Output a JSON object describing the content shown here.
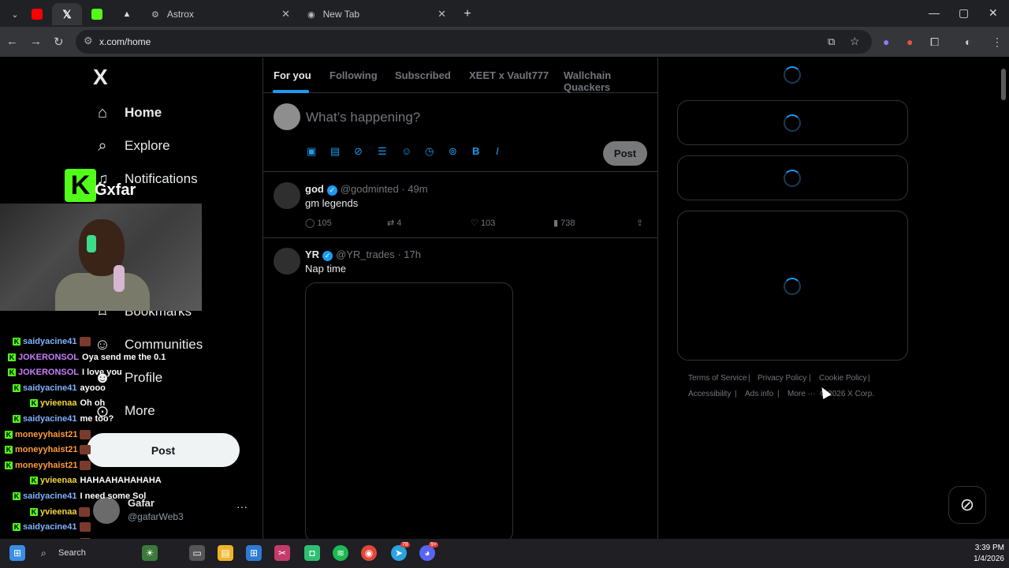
{
  "browser": {
    "tabs": [
      {
        "label": "",
        "favicon": "youtube-icon",
        "color": "#ff0000"
      },
      {
        "label": "",
        "favicon": "x-icon",
        "color": "#e7e9ea"
      },
      {
        "label": "",
        "favicon": "kick-icon",
        "color": "#53fc18"
      },
      {
        "label": "",
        "favicon": "drive-icon",
        "color": "#e7e9ea"
      },
      {
        "label": "Astrox",
        "favicon": "globe-icon"
      },
      {
        "label": "New Tab",
        "favicon": "chrome-icon"
      }
    ],
    "new_tab_symbol": "+",
    "url": "x.com/home"
  },
  "sidebar": {
    "logo": "X",
    "items": [
      {
        "label": "Home",
        "icon": "home-icon"
      },
      {
        "label": "Explore",
        "icon": "search-icon"
      },
      {
        "label": "Notifications",
        "icon": "bell-icon"
      },
      {
        "label": "Bookmarks",
        "icon": "bookmark-icon"
      },
      {
        "label": "Communities",
        "icon": "communities-icon"
      },
      {
        "label": "Profile",
        "icon": "person-icon"
      },
      {
        "label": "More",
        "icon": "more-circle-icon"
      }
    ],
    "post_label": "Post",
    "account": {
      "name": "Gafar",
      "handle": "@gafarWeb3"
    }
  },
  "stream": {
    "logo_letter": "K",
    "name": "Gxfar",
    "chat": [
      {
        "user": "saidyacine41",
        "color": "#7fb2ff",
        "msg": ""
      },
      {
        "user": "JOKERONSOL",
        "color": "#c77dff",
        "msg": "Oya send me the 0.1"
      },
      {
        "user": "JOKERONSOL",
        "color": "#c77dff",
        "msg": "I love you"
      },
      {
        "user": "saidyacine41",
        "color": "#7fb2ff",
        "msg": "ayooo"
      },
      {
        "user": "yvieenaa",
        "color": "#f5d33b",
        "msg": "Oh oh"
      },
      {
        "user": "saidyacine41",
        "color": "#7fb2ff",
        "msg": "me too?"
      },
      {
        "user": "moneyyhaist21",
        "color": "#ff9b3d",
        "msg": ""
      },
      {
        "user": "moneyyhaist21",
        "color": "#ff9b3d",
        "msg": ""
      },
      {
        "user": "moneyyhaist21",
        "color": "#ff9b3d",
        "msg": ""
      },
      {
        "user": "yvieenaa",
        "color": "#f5d33b",
        "msg": "HAHAAHAHAHAHA"
      },
      {
        "user": "saidyacine41",
        "color": "#7fb2ff",
        "msg": "I need some Sol"
      },
      {
        "user": "yvieenaa",
        "color": "#f5d33b",
        "msg": ""
      },
      {
        "user": "saidyacine41",
        "color": "#7fb2ff",
        "msg": ""
      },
      {
        "user": "saidyacine41",
        "color": "#7fb2ff",
        "msg": ""
      },
      {
        "user": "saidyacine41",
        "color": "#7fb2ff",
        "msg": ""
      }
    ]
  },
  "timeline": {
    "tabs": [
      "For you",
      "Following",
      "Subscribed",
      "XEET x Vault777",
      "Wallchain Quackers"
    ],
    "composer_placeholder": "What’s happening?",
    "post_label": "Post",
    "tweets": [
      {
        "name": "god",
        "handle": "@godminted",
        "time": "· 49m",
        "text": "gm legends",
        "replies": "105",
        "retweets": "4",
        "likes": "103",
        "views": "738"
      },
      {
        "name": "YR",
        "handle": "@YR_trades",
        "time": "· 17h",
        "text": "Nap time"
      }
    ]
  },
  "footer": {
    "links": [
      "Terms of Service",
      "Privacy Policy",
      "Cookie Policy",
      "Accessibility",
      "Ads info",
      "More ···",
      "© 2026 X Corp."
    ]
  },
  "taskbar": {
    "search_label": "Search",
    "time": "3:39 PM",
    "date": "1/4/2026",
    "telegram_badge": "78",
    "discord_badge": "9+"
  }
}
